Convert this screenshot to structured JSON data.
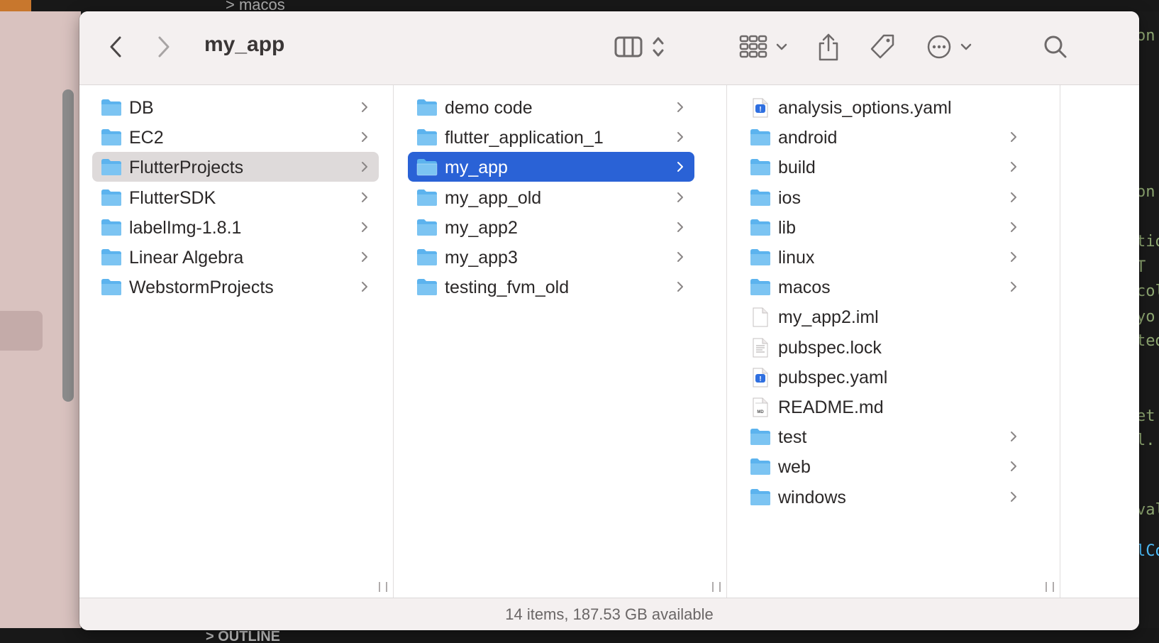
{
  "background": {
    "breadcrumb": "> macos",
    "outline_label": "> OUTLINE",
    "editor_fragments": [
      "on",
      "on",
      "tio",
      "T",
      "col",
      "yo",
      "ted",
      "et",
      "l.",
      "val",
      "lCo"
    ]
  },
  "toolbar": {
    "title": "my_app",
    "icons": [
      "back-icon",
      "forward-icon",
      "columns-view-icon",
      "view-stepper-icon",
      "group-icon",
      "share-icon",
      "tag-icon",
      "more-icon",
      "search-icon"
    ]
  },
  "columns": [
    {
      "items": [
        {
          "name": "DB",
          "kind": "folder",
          "chevron": true
        },
        {
          "name": "EC2",
          "kind": "folder",
          "chevron": true
        },
        {
          "name": "FlutterProjects",
          "kind": "folder",
          "chevron": true,
          "state": "selected-inactive"
        },
        {
          "name": "FlutterSDK",
          "kind": "folder",
          "chevron": true
        },
        {
          "name": "labelImg-1.8.1",
          "kind": "folder",
          "chevron": true
        },
        {
          "name": "Linear Algebra",
          "kind": "folder",
          "chevron": true
        },
        {
          "name": "WebstormProjects",
          "kind": "folder",
          "chevron": true
        }
      ]
    },
    {
      "items": [
        {
          "name": "demo code",
          "kind": "folder",
          "chevron": true
        },
        {
          "name": "flutter_application_1",
          "kind": "folder",
          "chevron": true
        },
        {
          "name": "my_app",
          "kind": "folder",
          "chevron": true,
          "state": "selected"
        },
        {
          "name": "my_app_old",
          "kind": "folder",
          "chevron": true
        },
        {
          "name": "my_app2",
          "kind": "folder",
          "chevron": true
        },
        {
          "name": "my_app3",
          "kind": "folder",
          "chevron": true
        },
        {
          "name": "testing_fvm_old",
          "kind": "folder",
          "chevron": true
        }
      ]
    },
    {
      "items": [
        {
          "name": "analysis_options.yaml",
          "kind": "yaml",
          "chevron": false
        },
        {
          "name": "android",
          "kind": "folder",
          "chevron": true
        },
        {
          "name": "build",
          "kind": "folder",
          "chevron": true
        },
        {
          "name": "ios",
          "kind": "folder",
          "chevron": true
        },
        {
          "name": "lib",
          "kind": "folder",
          "chevron": true
        },
        {
          "name": "linux",
          "kind": "folder",
          "chevron": true
        },
        {
          "name": "macos",
          "kind": "folder",
          "chevron": true
        },
        {
          "name": "my_app2.iml",
          "kind": "file",
          "chevron": false
        },
        {
          "name": "pubspec.lock",
          "kind": "text",
          "chevron": false
        },
        {
          "name": "pubspec.yaml",
          "kind": "yaml",
          "chevron": false
        },
        {
          "name": "README.md",
          "kind": "md",
          "chevron": false
        },
        {
          "name": "test",
          "kind": "folder",
          "chevron": true
        },
        {
          "name": "web",
          "kind": "folder",
          "chevron": true
        },
        {
          "name": "windows",
          "kind": "folder",
          "chevron": true
        }
      ]
    }
  ],
  "status": {
    "text": "14 items, 187.53 GB available"
  },
  "colors": {
    "selection": "#2a62d6",
    "folder": "#5cb3ee",
    "folder_tab": "#7cc4f2",
    "selection_inactive": "#dedada"
  }
}
